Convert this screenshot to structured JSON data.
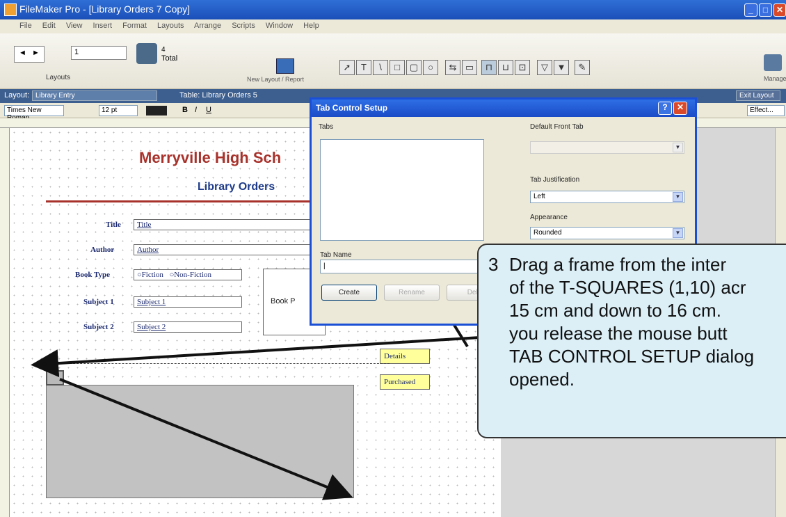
{
  "window": {
    "title": "FileMaker Pro - [Library Orders 7 Copy]",
    "controls": {
      "minimize": "_",
      "restore": "□",
      "close": "✕"
    }
  },
  "menu": [
    "File",
    "Edit",
    "View",
    "Insert",
    "Format",
    "Layouts",
    "Arrange",
    "Scripts",
    "Window",
    "Help"
  ],
  "toolbar": {
    "layout_number": "1",
    "layouts_label": "Layouts",
    "total_count": "4",
    "total_label": "Total",
    "new_layout_label": "New Layout / Report",
    "manage_label": "Manage"
  },
  "layout_bar": {
    "layout_label": "Layout:",
    "layout_value": "Library Entry",
    "table_label": "Table: Library Orders 5",
    "exit_label": "Exit Layout"
  },
  "format_bar": {
    "font": "Times New Roman",
    "size": "12 pt",
    "bold": "B",
    "italic": "I",
    "underline": "U",
    "effects": "Effect..."
  },
  "form": {
    "school_title": "Merryville High Sch",
    "subtitle": "Library Orders",
    "title_label": "Title",
    "title_field": "Title",
    "author_label": "Author",
    "author_field": "Author",
    "book_type_label": "Book Type",
    "radio_fiction": "Fiction",
    "radio_nonfiction": "Non-Fiction",
    "subject1_label": "Subject 1",
    "subject1_field": "Subject 1",
    "subject2_label": "Subject 2",
    "subject2_field": "Subject 2",
    "book_price_label": "Book P",
    "details_button": "Details",
    "purchased_button": "Purchased"
  },
  "dialog": {
    "title": "Tab Control Setup",
    "help": "?",
    "close": "✕",
    "tabs_label": "Tabs",
    "default_front_tab_label": "Default Front Tab",
    "tab_justification_label": "Tab Justification",
    "tab_justification_value": "Left",
    "appearance_label": "Appearance",
    "appearance_value": "Rounded",
    "tab_name_label": "Tab Name",
    "create_button": "Create",
    "rename_button": "Rename",
    "third_button": "Dele"
  },
  "callout": {
    "step": "3",
    "lines": [
      "Drag a frame from the inter",
      "of the T-SQUARES (1,10) acr",
      "15 cm and down to 16 cm.",
      "you release the mouse butt",
      "TAB CONTROL SETUP dialog",
      "opened."
    ]
  },
  "colors": {
    "title_bar": "#1b4fb8",
    "heading_red": "#a8322b",
    "form_navy": "#1c2a6e",
    "callout_fill": "#dceff7",
    "button_yellow": "#ffff9c"
  }
}
